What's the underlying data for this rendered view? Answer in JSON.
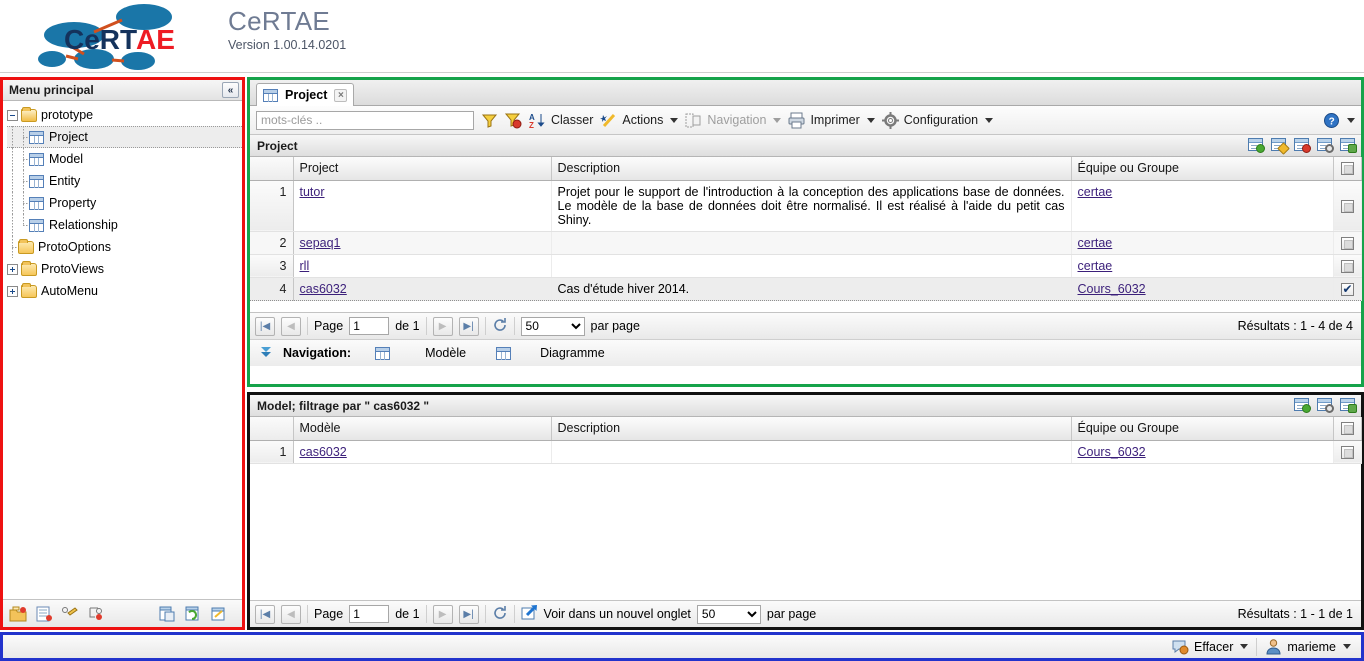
{
  "header": {
    "logo_text_dark": "CeRT",
    "logo_text_red": "AE",
    "app_title": "CeRTAE",
    "version": "Version 1.00.14.0201"
  },
  "sidebar": {
    "title": "Menu principal",
    "collapse_icon": "«",
    "items": [
      {
        "label": "prototype",
        "icon": "folder-open-icon",
        "level": 0,
        "expander": "minus"
      },
      {
        "label": "Project",
        "icon": "grid-icon",
        "level": 1,
        "expander": "none",
        "selected": true
      },
      {
        "label": "Model",
        "icon": "grid-icon",
        "level": 1,
        "expander": "none"
      },
      {
        "label": "Entity",
        "icon": "grid-icon",
        "level": 1,
        "expander": "none"
      },
      {
        "label": "Property",
        "icon": "grid-icon",
        "level": 1,
        "expander": "none"
      },
      {
        "label": "Relationship",
        "icon": "grid-icon",
        "level": 1,
        "expander": "none"
      },
      {
        "label": "ProtoOptions",
        "icon": "folder-icon",
        "level": 0,
        "expander": "none"
      },
      {
        "label": "ProtoViews",
        "icon": "folder-icon",
        "level": 0,
        "expander": "plus"
      },
      {
        "label": "AutoMenu",
        "icon": "folder-icon",
        "level": 0,
        "expander": "plus"
      }
    ],
    "footer_icons": [
      "new-folder-icon",
      "new-list-icon",
      "edit-node-icon",
      "delete-node-icon",
      "copy-page-icon",
      "refresh-page-icon",
      "export-page-icon"
    ]
  },
  "project_panel": {
    "tab": {
      "label": "Project",
      "icon": "grid-icon",
      "close": "×"
    },
    "toolbar": {
      "search_placeholder": "mots-clés ..",
      "search_value": "",
      "items": [
        {
          "label": "",
          "icon": "filter-icon"
        },
        {
          "label": "",
          "icon": "filter-clear-icon"
        },
        {
          "label": "Classer",
          "icon": "sort-az-icon"
        },
        {
          "label": "Actions",
          "icon": "wand-icon",
          "caret": true
        },
        {
          "label": "Navigation",
          "icon": "navigation-icon",
          "caret": true,
          "disabled": true
        },
        {
          "label": "Imprimer",
          "icon": "printer-icon",
          "caret": true
        },
        {
          "label": "Configuration",
          "icon": "gear-icon",
          "caret": true
        }
      ],
      "help": {
        "icon": "help-icon",
        "caret": true
      }
    },
    "grid_title": "Project",
    "grid_icons": [
      "add-record-icon",
      "edit-record-icon",
      "delete-record-icon",
      "view-record-icon",
      "refresh-grid-icon"
    ],
    "columns": [
      "",
      "Project",
      "Description",
      "Équipe ou Groupe",
      ""
    ],
    "rows": [
      {
        "num": "1",
        "project": "tutor",
        "description": "Projet pour le support de l'introduction à la conception des applications base de données. Le modèle de la base de données doit être normalisé. Il est réalisé à l'aide du petit cas Shiny.",
        "team": "certae",
        "checked": false
      },
      {
        "num": "2",
        "project": "sepaq1",
        "description": "",
        "team": "certae",
        "checked": false
      },
      {
        "num": "3",
        "project": "rll",
        "description": "",
        "team": "certae",
        "checked": false
      },
      {
        "num": "4",
        "project": "cas6032",
        "description": "Cas d'étude hiver 2014.",
        "team": "Cours_6032",
        "checked": true
      }
    ],
    "pager": {
      "first": "|◀",
      "prev": "◀",
      "next": "▶",
      "last": "▶|",
      "refresh": "↻",
      "page_label": "Page",
      "page_value": "1",
      "of_label": "de 1",
      "per_page_value": "50",
      "per_page_label": "par page",
      "results": "Résultats : 1 - 4 de 4"
    },
    "navigation": {
      "label": "Navigation:",
      "links": [
        {
          "label": "Modèle",
          "icon": "grid-icon"
        },
        {
          "label": "Diagramme",
          "icon": "grid-icon"
        }
      ]
    }
  },
  "model_panel": {
    "grid_title": "Model; filtrage par \" cas6032 \"",
    "grid_icons": [
      "add-record-icon",
      "view-record-icon",
      "refresh-grid-icon"
    ],
    "columns": [
      "",
      "Modèle",
      "Description",
      "Équipe ou Groupe",
      ""
    ],
    "rows": [
      {
        "num": "1",
        "model": "cas6032",
        "description": "",
        "team": "Cours_6032",
        "checked": false
      }
    ],
    "pager": {
      "first": "|◀",
      "prev": "◀",
      "next": "▶",
      "last": "▶|",
      "refresh": "↻",
      "page_label": "Page",
      "page_value": "1",
      "of_label": "de 1",
      "new_tab_label": "Voir dans un nouvel onglet",
      "per_page_value": "50",
      "per_page_label": "par page",
      "results": "Résultats : 1 - 1 de 1"
    }
  },
  "status_bar": {
    "clear": {
      "label": "Effacer",
      "icon": "clear-icon",
      "caret": true
    },
    "user": {
      "label": "marieme",
      "icon": "user-icon",
      "caret": true
    }
  },
  "colors": {
    "sidebar_border": "#ee1111",
    "project_border": "#16a34a",
    "model_border": "#111111",
    "status_border": "#2233cc",
    "link": "#3b1f7a",
    "logo_blue": "#1a76a8",
    "logo_red": "#ee1c24",
    "title_gray": "#6f7b93"
  }
}
